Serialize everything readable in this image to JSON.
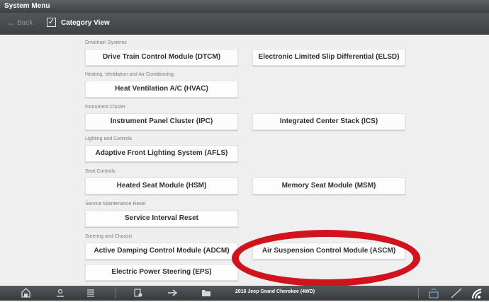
{
  "title_bar": {
    "title": "System Menu"
  },
  "toolbar": {
    "back_label": "Back",
    "back_icon": "arrow-left-icon",
    "category_checked": true,
    "category_label": "Category View"
  },
  "sections": [
    {
      "header": "Drivetrain Systems",
      "buttons": [
        "Drive Train Control Module (DTCM)",
        "Electronic Limited Slip Differential (ELSD)"
      ]
    },
    {
      "header": "Heating, Ventilation and Air Conditioning",
      "buttons": [
        "Heat Ventilation A/C (HVAC)"
      ]
    },
    {
      "header": "Instrument Cluster",
      "buttons": [
        "Instrument Panel Cluster (IPC)",
        "Integrated Center Stack (ICS)"
      ]
    },
    {
      "header": "Lighting and Controls",
      "buttons": [
        "Adaptive Front Lighting System (AFLS)"
      ]
    },
    {
      "header": "Seat Controls",
      "buttons": [
        "Heated Seat Module (HSM)",
        "Memory Seat Module (MSM)"
      ]
    },
    {
      "header": "Service Maintenance Reset",
      "buttons": [
        "Service Interval Reset"
      ]
    },
    {
      "header": "Steering and Chassis",
      "buttons": [
        "Active Damping Control Module (ADCM)",
        "Air Suspension Control Module (ASCM)",
        "Electric Power Steering (EPS)"
      ]
    }
  ],
  "annotation": {
    "highlight_color": "#d0131c"
  },
  "bottom_bar": {
    "vehicle": "2016 Jeep Grand Cherokee (4WD)",
    "icons": [
      "home-icon",
      "vehicle-id-icon",
      "list-icon",
      "scan-icon",
      "tools-icon",
      "folder-icon",
      "vci-status-icon",
      "signal-off-icon",
      "wireless-icon"
    ]
  }
}
